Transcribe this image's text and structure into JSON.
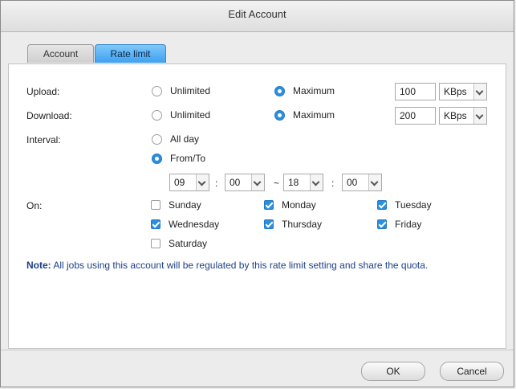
{
  "dialog": {
    "title": "Edit Account"
  },
  "tabs": [
    {
      "label": "Account",
      "active": false
    },
    {
      "label": "Rate limit",
      "active": true
    }
  ],
  "upload": {
    "label": "Upload:",
    "unlimited_label": "Unlimited",
    "maximum_label": "Maximum",
    "selected": "maximum",
    "value": "100",
    "unit": "KBps"
  },
  "download": {
    "label": "Download:",
    "unlimited_label": "Unlimited",
    "maximum_label": "Maximum",
    "selected": "maximum",
    "value": "200",
    "unit": "KBps"
  },
  "interval": {
    "label": "Interval:",
    "all_day_label": "All day",
    "from_to_label": "From/To",
    "selected": "from_to",
    "from_hour": "09",
    "from_minute": "00",
    "to_hour": "18",
    "to_minute": "00",
    "time_sep": ":",
    "range_sep": "~"
  },
  "on": {
    "label": "On:",
    "days": [
      {
        "label": "Sunday",
        "checked": false
      },
      {
        "label": "Monday",
        "checked": true
      },
      {
        "label": "Tuesday",
        "checked": true
      },
      {
        "label": "Wednesday",
        "checked": true
      },
      {
        "label": "Thursday",
        "checked": true
      },
      {
        "label": "Friday",
        "checked": true
      },
      {
        "label": "Saturday",
        "checked": false
      }
    ]
  },
  "note": {
    "prefix": "Note:",
    "text": " All jobs using this account will be regulated by this rate limit setting and share the quota."
  },
  "buttons": {
    "ok": "OK",
    "cancel": "Cancel"
  },
  "colors": {
    "accent": "#2b8fe0",
    "active_tab": "#3ea1ef",
    "note_text": "#1c3f86"
  }
}
